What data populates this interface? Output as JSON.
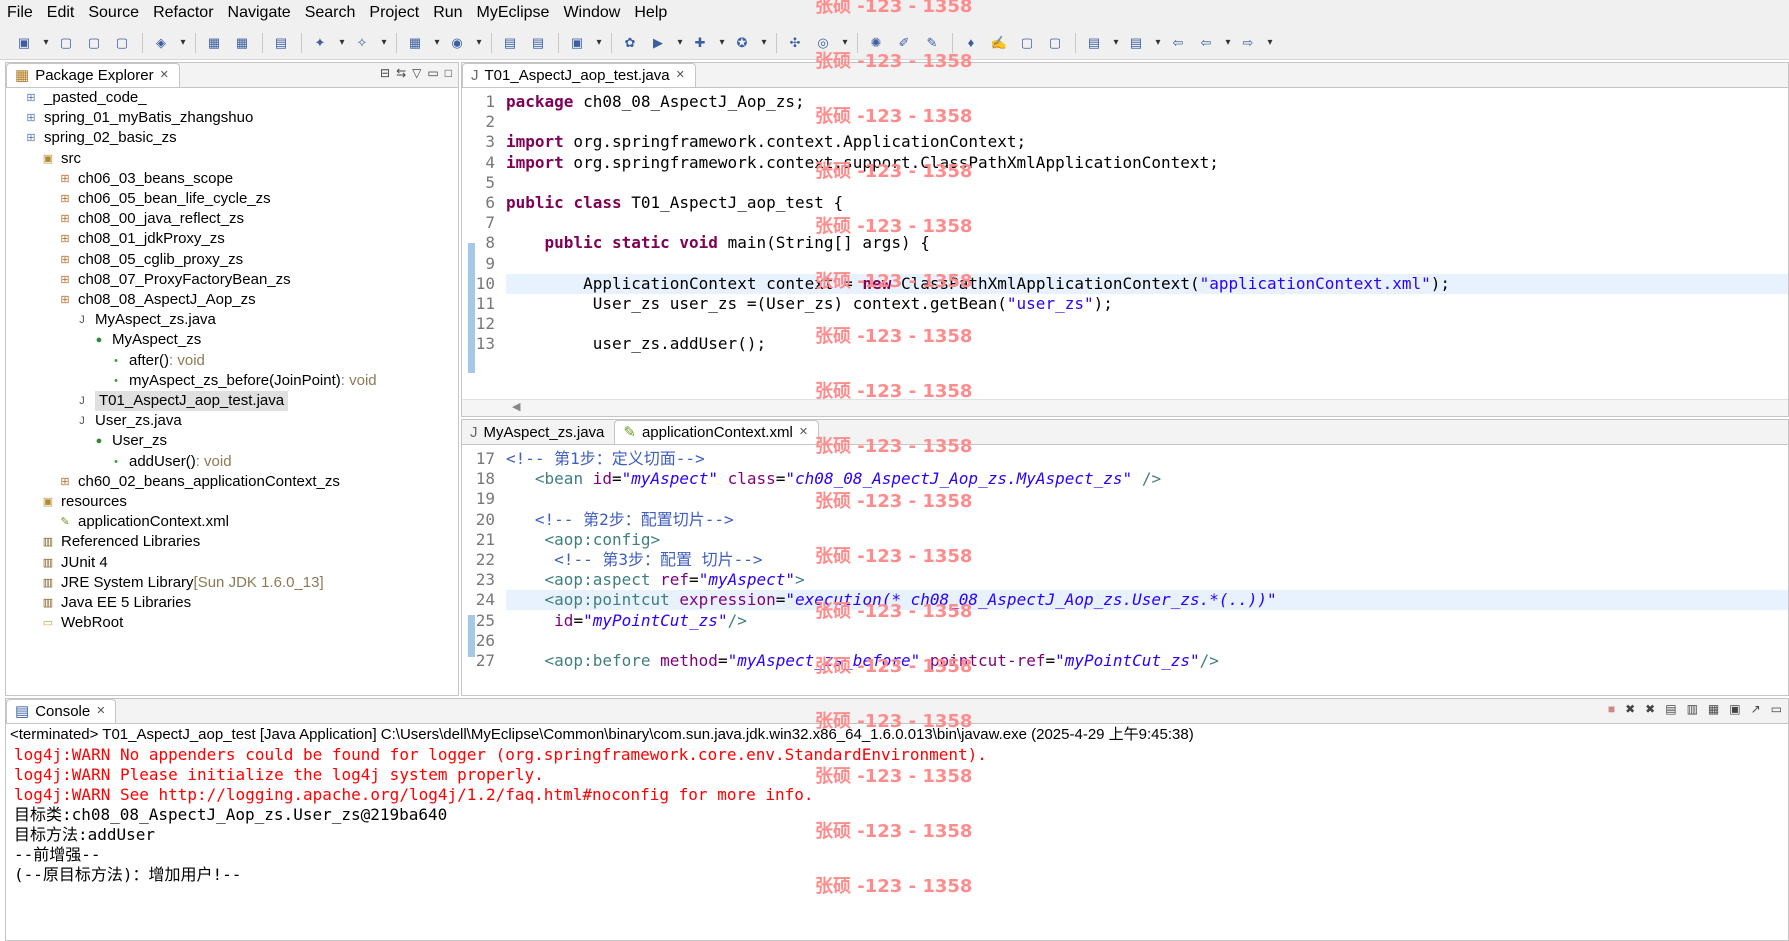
{
  "menu": [
    "File",
    "Edit",
    "Source",
    "Refactor",
    "Navigate",
    "Search",
    "Project",
    "Run",
    "MyEclipse",
    "Window",
    "Help"
  ],
  "explorer": {
    "title": "Package Explorer",
    "items": [
      {
        "label": "_pasted_code_",
        "icon": "project-icon",
        "indent": 0
      },
      {
        "label": "spring_01_myBatis_zhangshuo",
        "icon": "project-icon",
        "indent": 0
      },
      {
        "label": "spring_02_basic_zs",
        "icon": "project-icon",
        "indent": 0
      },
      {
        "label": "src",
        "icon": "source-folder-icon",
        "indent": 1
      },
      {
        "label": "ch06_03_beans_scope",
        "icon": "package-icon",
        "indent": 2
      },
      {
        "label": "ch06_05_bean_life_cycle_zs",
        "icon": "package-icon",
        "indent": 2
      },
      {
        "label": "ch08_00_java_reflect_zs",
        "icon": "package-icon",
        "indent": 2
      },
      {
        "label": "ch08_01_jdkProxy_zs",
        "icon": "package-icon",
        "indent": 2
      },
      {
        "label": "ch08_05_cglib_proxy_zs",
        "icon": "package-icon",
        "indent": 2
      },
      {
        "label": "ch08_07_ProxyFactoryBean_zs",
        "icon": "package-icon",
        "indent": 2
      },
      {
        "label": "ch08_08_AspectJ_Aop_zs",
        "icon": "package-icon",
        "indent": 2
      },
      {
        "label": "MyAspect_zs.java",
        "icon": "java-file-icon",
        "indent": 3
      },
      {
        "label": "MyAspect_zs",
        "icon": "class-icon",
        "indent": 4
      },
      {
        "label": "after()",
        "type": " : void",
        "icon": "method-icon",
        "indent": 5
      },
      {
        "label": "myAspect_zs_before(JoinPoint)",
        "type": " : void",
        "icon": "method-icon",
        "indent": 5
      },
      {
        "label": "T01_AspectJ_aop_test.java",
        "icon": "java-file-icon",
        "indent": 3,
        "selected": true
      },
      {
        "label": "User_zs.java",
        "icon": "java-file-icon",
        "indent": 3
      },
      {
        "label": "User_zs",
        "icon": "class-icon",
        "indent": 4
      },
      {
        "label": "addUser()",
        "type": " : void",
        "icon": "method-icon",
        "indent": 5
      },
      {
        "label": "ch60_02_beans_applicationContext_zs",
        "icon": "package-icon",
        "indent": 2
      },
      {
        "label": "resources",
        "icon": "source-folder-icon",
        "indent": 1
      },
      {
        "label": "applicationContext.xml",
        "icon": "xml-file-icon",
        "indent": 2
      },
      {
        "label": "Referenced Libraries",
        "icon": "library-icon",
        "indent": 1
      },
      {
        "label": "JUnit 4",
        "icon": "library-icon",
        "indent": 1
      },
      {
        "label": "JRE System Library",
        "type": " [Sun JDK 1.6.0_13]",
        "icon": "library-icon",
        "indent": 1
      },
      {
        "label": "Java EE 5 Libraries",
        "icon": "library-icon",
        "indent": 1
      },
      {
        "label": "WebRoot",
        "icon": "folder-icon",
        "indent": 1
      }
    ]
  },
  "editor_top": {
    "tab": "T01_AspectJ_aop_test.java",
    "lines": [
      {
        "n": "1",
        "html": "<span class='kw'>package</span> ch08_08_AspectJ_Aop_zs;"
      },
      {
        "n": "2",
        "html": ""
      },
      {
        "n": "3",
        "html": "<span class='kw'>import</span> org.springframework.context.ApplicationContext;"
      },
      {
        "n": "4",
        "html": "<span class='kw'>import</span> org.springframework.context.support.ClassPathXmlApplicationContext;"
      },
      {
        "n": "5",
        "html": ""
      },
      {
        "n": "6",
        "html": "<span class='kw'>public</span> <span class='kw'>class</span> T01_AspectJ_aop_test {"
      },
      {
        "n": "7",
        "html": ""
      },
      {
        "n": "8",
        "html": "    <span class='kw'>public</span> <span class='kw'>static</span> <span class='kw'>void</span> main(String[] args) {"
      },
      {
        "n": "9",
        "html": ""
      },
      {
        "n": "10",
        "html": "        ApplicationContext context = <span class='kw'>new</span> ClassPathXmlApplicationContext(<span class='str'>\"applicationContext.xml\"</span>);",
        "hl": true
      },
      {
        "n": "11",
        "html": "         User_zs user_zs =(User_zs) context.getBean(<span class='str'>\"user_zs\"</span>);"
      },
      {
        "n": "12",
        "html": ""
      },
      {
        "n": "13",
        "html": "         user_zs.addUser();"
      }
    ]
  },
  "editor_bottom": {
    "tabs": [
      "MyAspect_zs.java",
      "applicationContext.xml"
    ],
    "lines": [
      {
        "n": "17",
        "html": "<span class='cm'>&lt;!-- 第1步：定义切面--&gt;</span>"
      },
      {
        "n": "18",
        "html": "   <span class='tag'>&lt;bean</span> <span class='attr'>id</span>=<span class='aval'>\"myAspect\"</span> <span class='attr'>class</span>=<span class='aval'>\"ch08_08_AspectJ_Aop_zs.MyAspect_zs\"</span> <span class='tag'>/&gt;</span>"
      },
      {
        "n": "19",
        "html": ""
      },
      {
        "n": "20",
        "html": "   <span class='cm'>&lt;!-- 第2步：配置切片--&gt;</span>"
      },
      {
        "n": "21",
        "html": "    <span class='tag'>&lt;aop:config&gt;</span>"
      },
      {
        "n": "22",
        "html": "     <span class='cm'>&lt;!-- 第3步：配置 切片--&gt;</span>"
      },
      {
        "n": "23",
        "html": "    <span class='tag'>&lt;aop:aspect</span> <span class='attr'>ref</span>=<span class='aval'>\"myAspect\"</span><span class='tag'>&gt;</span>"
      },
      {
        "n": "24",
        "html": "    <span class='tag'>&lt;aop:pointcut</span> <span class='attr'>expression</span>=<span class='aval'>\"execution(* ch08_08_AspectJ_Aop_zs.User_zs.*(..))\"</span>",
        "hl": true
      },
      {
        "n": "25",
        "html": "     <span class='attr'>id</span>=<span class='aval'>\"myPointCut_zs\"</span><span class='tag'>/&gt;</span>"
      },
      {
        "n": "26",
        "html": ""
      },
      {
        "n": "27",
        "html": "    <span class='tag'>&lt;aop:before</span> <span class='attr'>method</span>=<span class='aval'>\"myAspect_zs_before\"</span> <span class='attr'>pointcut-ref</span>=<span class='aval'>\"myPointCut_zs\"</span><span class='tag'>/&gt;</span>"
      }
    ]
  },
  "console": {
    "title": "Console",
    "header": "<terminated> T01_AspectJ_aop_test [Java Application] C:\\Users\\dell\\MyEclipse\\Common\\binary\\com.sun.java.jdk.win32.x86_64_1.6.0.013\\bin\\javaw.exe (2025-4-29 上午9:45:38)",
    "lines": [
      {
        "text": "log4j:WARN No appenders could be found for logger (org.springframework.core.env.StandardEnvironment).",
        "red": true
      },
      {
        "text": "log4j:WARN Please initialize the log4j system properly.",
        "red": true
      },
      {
        "text": "log4j:WARN See http://logging.apache.org/log4j/1.2/faq.html#noconfig for more info.",
        "red": true
      },
      {
        "text": "目标类:ch08_08_AspectJ_Aop_zs.User_zs@219ba640",
        "red": false
      },
      {
        "text": "目标方法:addUser",
        "red": false
      },
      {
        "text": "--前增强--",
        "red": false
      },
      {
        "text": "(--原目标方法)：增加用户!--",
        "red": false
      }
    ]
  },
  "watermark": "张硕 -123 - 1358"
}
